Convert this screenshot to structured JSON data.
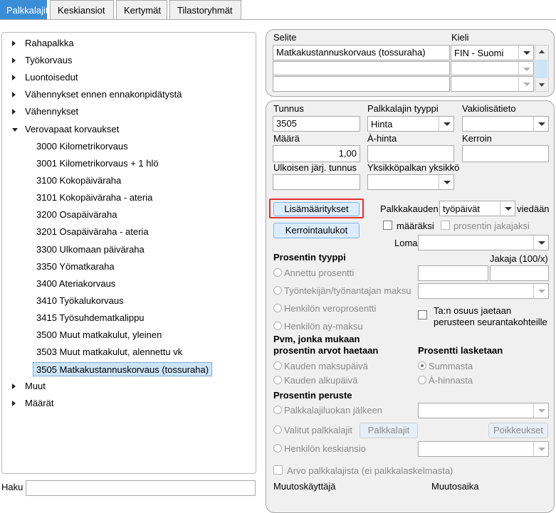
{
  "tabs": [
    "Palkkalajit",
    "Keskiansiot",
    "Kertymät",
    "Tilastoryhmät"
  ],
  "tree": {
    "rahapalkka": "Rahapalkka",
    "tyokorvaus": "Työkorvaus",
    "luontoisedut": "Luontoisedut",
    "vahennykset_ennen": "Vähennykset ennen ennakonpidätystä",
    "vahennykset": "Vähennykset",
    "verovapaat": "Verovapaat korvaukset",
    "children": [
      "3000 Kilometrikorvaus",
      "3001 Kilometrikorvaus + 1 hlö",
      "3100 Kokopäiväraha",
      "3101 Kokopäiväraha - ateria",
      "3200 Osapäiväraha",
      "3201 Osapäiväraha - ateria",
      "3300 Ulkomaan päiväraha",
      "3350 Yömatkaraha",
      "3400 Ateriakorvaus",
      "3410 Työkalukorvaus",
      "3415 Työsuhdematkalippu",
      "3500 Muut matkakulut, yleinen",
      "3503 Muut matkakulut, alennettu vk",
      "3505 Matkakustannuskorvaus (tossuraha)"
    ],
    "muut": "Muut",
    "maarat": "Määrät"
  },
  "search": {
    "label": "Haku",
    "value": ""
  },
  "desc": {
    "selite_label": "Selite",
    "kieli_label": "Kieli",
    "selite_value": "Matkakustannuskorvaus (tossuraha)",
    "kieli_value": "FIN - Suomi"
  },
  "form": {
    "tunnus_label": "Tunnus",
    "tunnus_value": "3505",
    "tyyppi_label": "Palkkalajin tyyppi",
    "tyyppi_value": "Hinta",
    "vakio_label": "Vakiolisätieto",
    "vakio_value": "",
    "maara_label": "Määrä",
    "maara_value": "1,00",
    "ahinta_label": "À-hinta",
    "kerroin_label": "Kerroin",
    "ulkoinen_label": "Ulkoisen järj. tunnus",
    "yksikko_label": "Yksikköpalkan yksikkö",
    "lisa_button": "Lisämääritykset",
    "kerroin_button": "Kerrointaulukot",
    "palkkakauden_label": "Palkkakauden",
    "palkkakauden_value": "työpäivät",
    "viedaan_label": "viedään",
    "maaraksi_label": "määräksi",
    "prosentin_jakajaksi_label": "prosentin jakajaksi",
    "loma_label": "Loma",
    "prosentin_tyyppi": "Prosentin tyyppi",
    "jakaja_label": "Jakaja (100/x)",
    "annettu": "Annettu prosentti",
    "tyontekija": "Työntekijän/työnantajan maksu",
    "veroprosentti": "Henkilön veroprosentti",
    "ay_maksu": "Henkilön ay-maksu",
    "tan_osuus_1": "Ta:n osuus jaetaan",
    "tan_osuus_2": "perusteen seurantakohteille",
    "pvm_1": "Pvm, jonka mukaan",
    "pvm_2": "prosentin arvot haetaan",
    "kauden_maksu": "Kauden maksupäivä",
    "kauden_alku": "Kauden alkupäivä",
    "prosentti_lasketaan": "Prosentti lasketaan",
    "summasta": "Summasta",
    "ahinnasta": "À-hinnasta",
    "prosentin_peruste": "Prosentin peruste",
    "luokan_jalkeen": "Palkkalajiluokan jälkeen",
    "valitut": "Valitut palkkalajit",
    "palkkalajit_button": "Palkkalajit",
    "poikkeukset_button": "Poikkeukset",
    "keskiansio": "Henkilön keskiansio",
    "arvo_palkkalajista": "Arvo palkkalajista (ei palkkalaskelmasta)",
    "muutoskayttaja": "Muutoskäyttäjä",
    "muutosaika": "Muutosaika"
  },
  "colors": {
    "accent": "#3a8ed8",
    "selection": "#cce4f7",
    "highlight": "#e0312f"
  }
}
